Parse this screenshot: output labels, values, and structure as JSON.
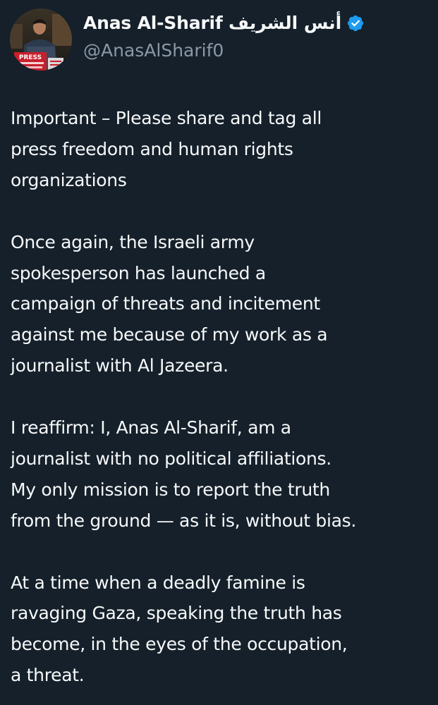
{
  "author": {
    "display_name": "Anas Al-Sharif أنس الشريف",
    "handle": "@AnasAlSharif0",
    "verified": true,
    "avatar_caption": "PRESS"
  },
  "tweet": {
    "paragraphs": [
      [
        "Important – Please share and tag all",
        "press freedom and human rights",
        "organizations"
      ],
      [
        "Once again, the Israeli army",
        "spokesperson has launched a",
        "campaign of threats and incitement",
        "against me because of my work as a",
        "journalist with Al Jazeera."
      ],
      [
        "I reaffirm: I, Anas Al-Sharif, am a",
        "journalist with no political affiliations.",
        "My only mission is to report the truth",
        "from the ground — as it is, without bias."
      ],
      [
        "At a time when a deadly famine is",
        "ravaging Gaza, speaking the truth has",
        "become, in the eyes of the occupation,",
        "a threat."
      ]
    ]
  },
  "colors": {
    "background": "#15202b",
    "text": "#f7f9f9",
    "secondary_text": "#8b98a5",
    "verified_badge": "#1d9bf0"
  }
}
